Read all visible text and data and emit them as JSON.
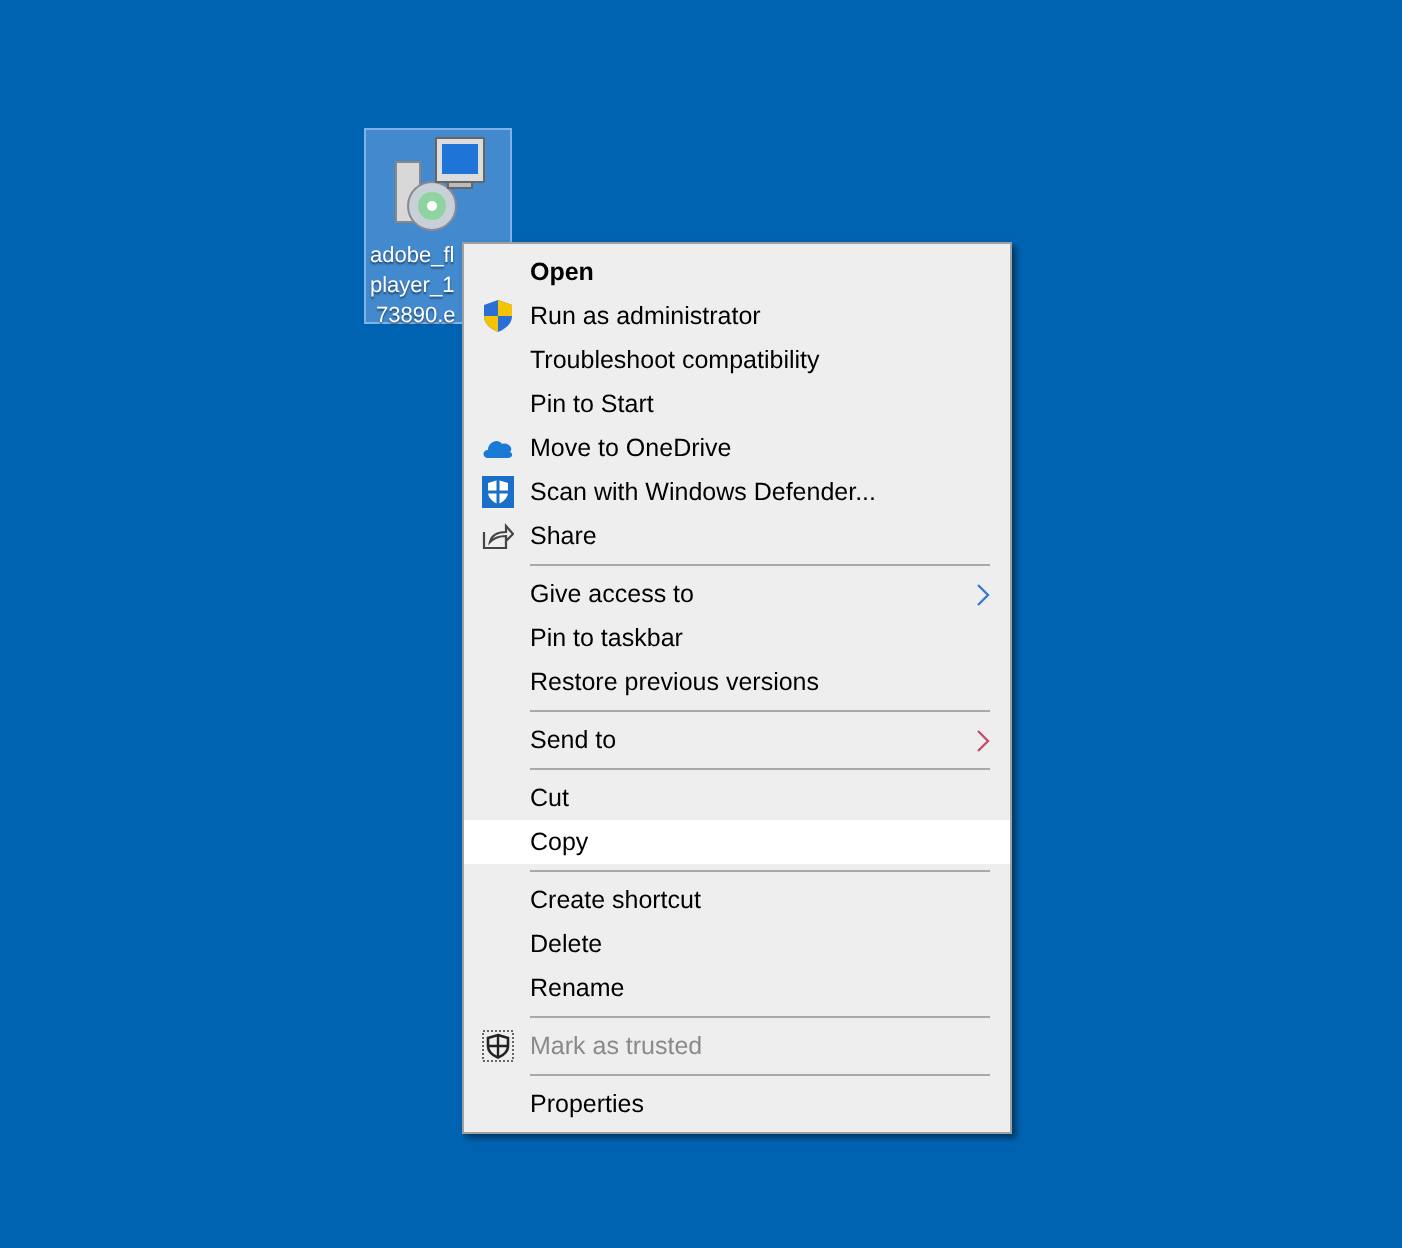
{
  "desktop_icon": {
    "label_lines": [
      "adobe_fl",
      "player_1",
      "73890.e"
    ],
    "selected": true
  },
  "context_menu": {
    "items": [
      {
        "kind": "item",
        "label": "Open",
        "bold": true,
        "selected": false
      },
      {
        "kind": "admin",
        "label": "Run as administrator",
        "selected": false
      },
      {
        "kind": "item",
        "label": "Troubleshoot compatibility",
        "selected": false
      },
      {
        "kind": "item",
        "label": "Pin to Start",
        "selected": false
      },
      {
        "kind": "cloud",
        "label": "Move to OneDrive",
        "selected": false
      },
      {
        "kind": "defender",
        "label": "Scan with Windows Defender...",
        "selected": false
      },
      {
        "kind": "share",
        "label": "Share",
        "selected": false
      },
      {
        "kind": "separator"
      },
      {
        "kind": "item",
        "label": "Give access to",
        "submenu": true,
        "color": "#3a7bc8",
        "selected": false
      },
      {
        "kind": "item",
        "label": "Pin to taskbar",
        "selected": false
      },
      {
        "kind": "item",
        "label": "Restore previous versions",
        "selected": false
      },
      {
        "kind": "separator"
      },
      {
        "kind": "item",
        "label": "Send to",
        "submenu": true,
        "color": "#c0506a",
        "selected": false
      },
      {
        "kind": "separator"
      },
      {
        "kind": "item",
        "label": "Cut",
        "selected": false
      },
      {
        "kind": "item",
        "label": "Copy",
        "selected": true
      },
      {
        "kind": "separator"
      },
      {
        "kind": "item",
        "label": "Create shortcut",
        "selected": false
      },
      {
        "kind": "item",
        "label": "Delete",
        "selected": false
      },
      {
        "kind": "item",
        "label": "Rename",
        "selected": false
      },
      {
        "kind": "separator"
      },
      {
        "kind": "trusted",
        "label": "Mark as trusted",
        "disabled": true,
        "selected": false
      },
      {
        "kind": "separator"
      },
      {
        "kind": "item",
        "label": "Properties",
        "selected": false
      }
    ]
  }
}
